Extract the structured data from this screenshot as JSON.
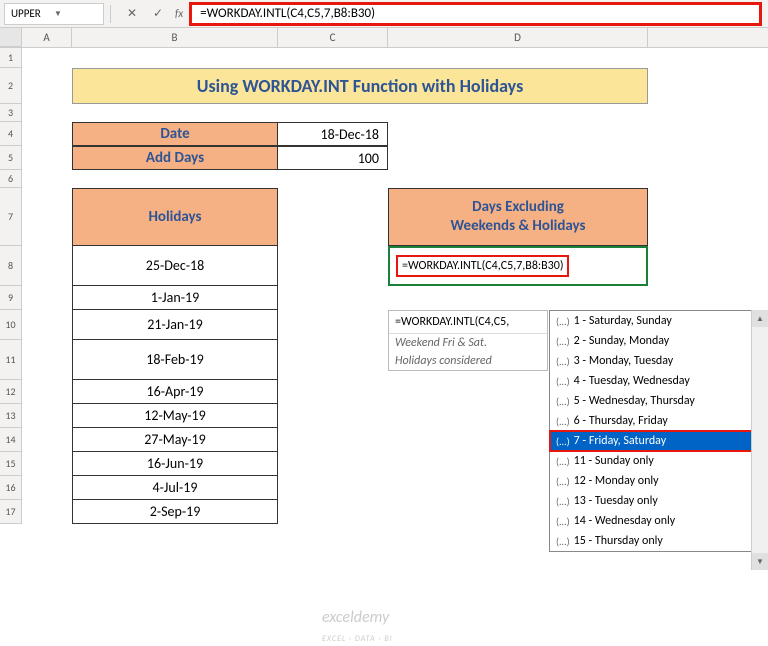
{
  "nameBox": "UPPER",
  "formula": "=WORKDAY.INTL(C4,C5,7,B8:B30)",
  "columns": {
    "A": "A",
    "B": "B",
    "C": "C",
    "D": "D"
  },
  "rows": [
    "1",
    "2",
    "3",
    "4",
    "5",
    "6",
    "7",
    "8",
    "9",
    "10",
    "11",
    "12",
    "13",
    "14",
    "15",
    "16",
    "17"
  ],
  "title": "Using WORKDAY.INT Function with Holidays",
  "table1": {
    "r1": {
      "label": "Date",
      "value": "18-Dec-18"
    },
    "r2": {
      "label": "Add Days",
      "value": "100"
    }
  },
  "holidaysHeader": "Holidays",
  "holidays": [
    "25-Dec-18",
    "1-Jan-19",
    "21-Jan-19",
    "18-Feb-19",
    "16-Apr-19",
    "12-May-19",
    "27-May-19",
    "16-Jun-19",
    "4-Jul-19",
    "2-Sep-19"
  ],
  "daysHeader": "Days Excluding\nWeekends & Holidays",
  "activeFormula": "=WORKDAY.INTL(C4,C5,7,B8:B30)",
  "hint": {
    "formula": "=WORKDAY.INTL(C4,C5,",
    "note1": "Weekend Fri & Sat.",
    "note2": "Holidays considered"
  },
  "dropdown": [
    "1 - Saturday, Sunday",
    "2 - Sunday, Monday",
    "3 - Monday, Tuesday",
    "4 - Tuesday, Wednesday",
    "5 - Wednesday, Thursday",
    "6 - Thursday, Friday",
    "7 - Friday, Saturday",
    "11 - Sunday only",
    "12 - Monday only",
    "13 - Tuesday only",
    "14 - Wednesday only",
    "15 - Thursday only"
  ],
  "ddIconPrefix": "(...)",
  "watermark": "exceldemy",
  "watermarkSub": "EXCEL · DATA · BI"
}
